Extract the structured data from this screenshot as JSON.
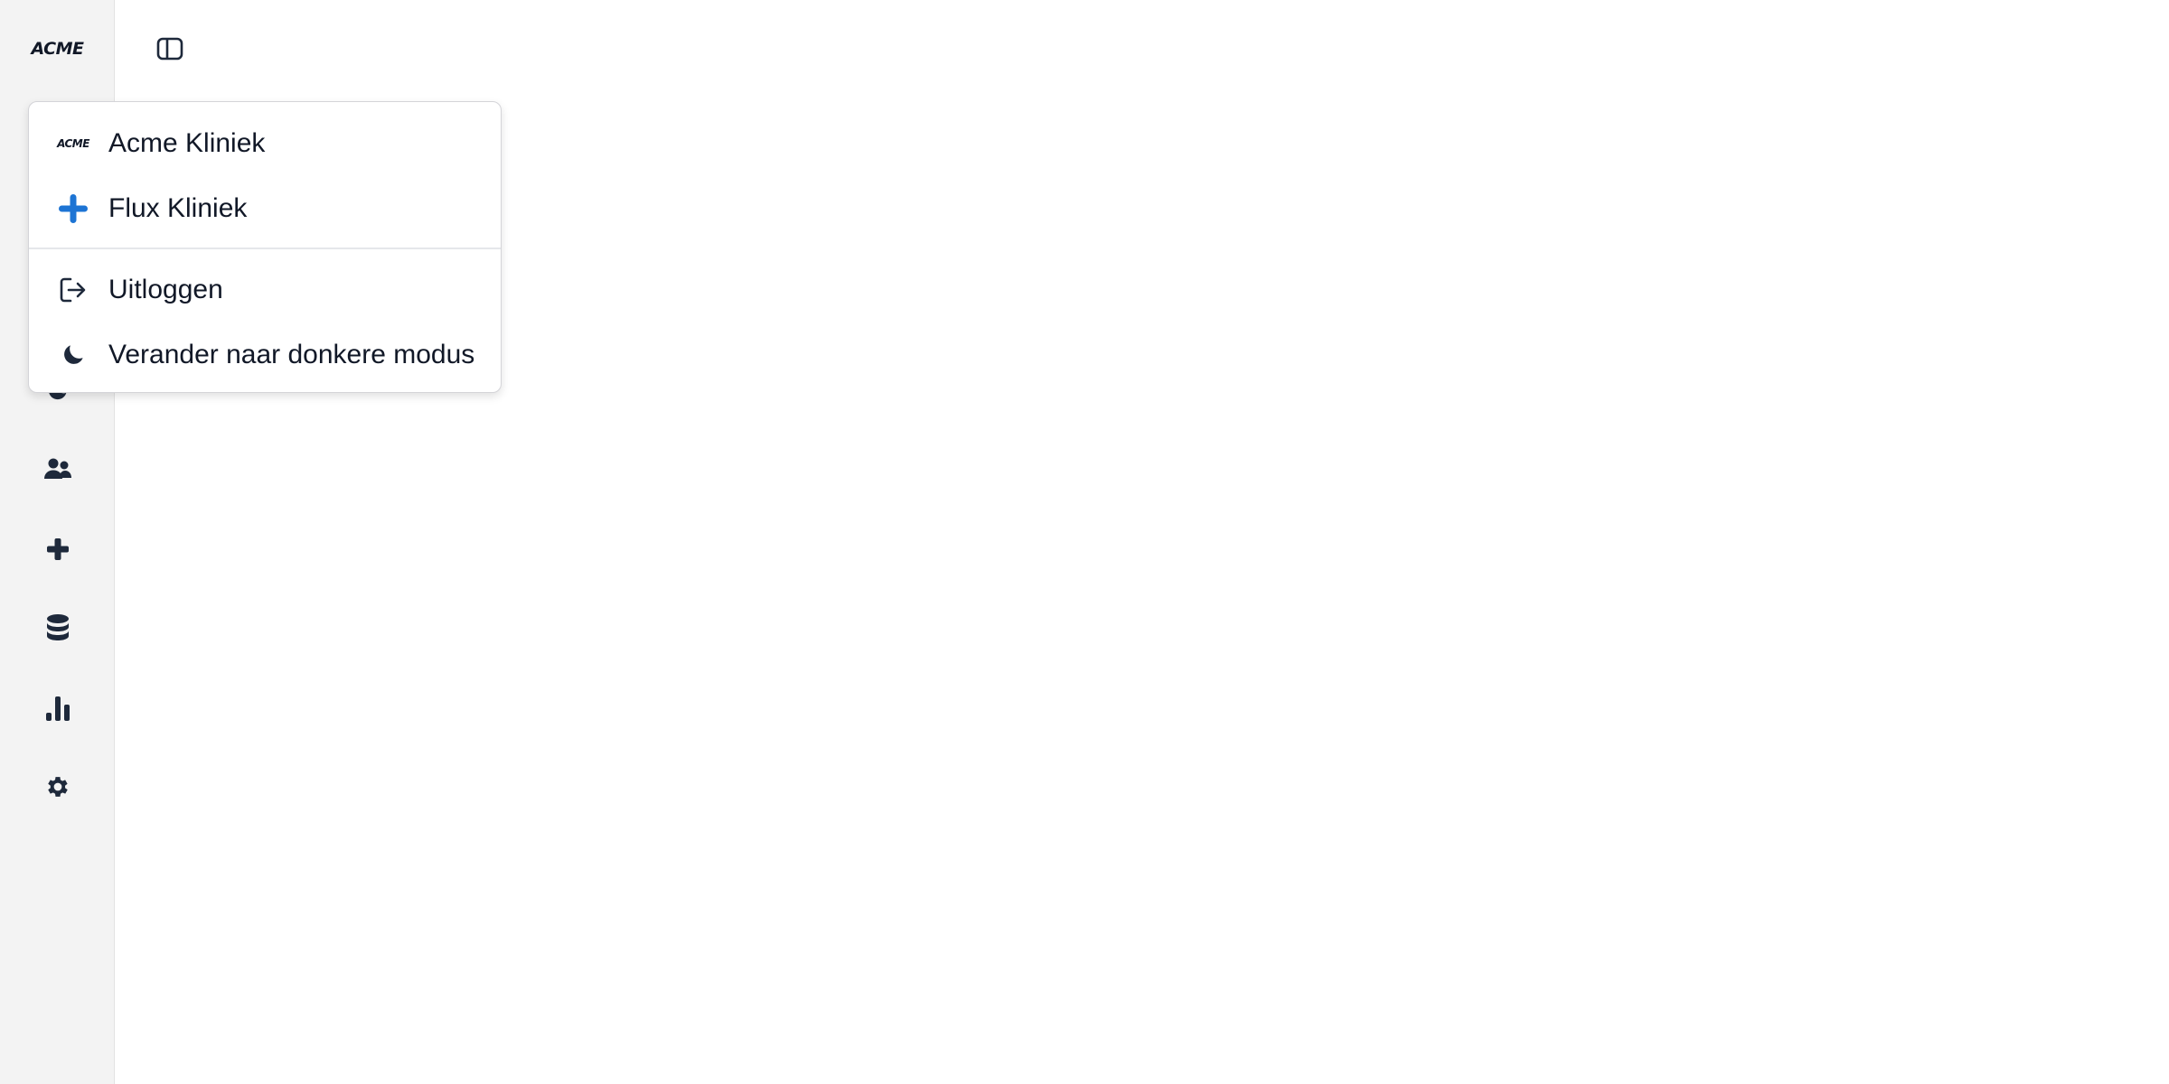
{
  "sidebar": {
    "logo_text": "ACME",
    "nav_icons": [
      {
        "name": "moon-icon"
      },
      {
        "name": "users-icon"
      },
      {
        "name": "plus-icon"
      },
      {
        "name": "database-icon"
      },
      {
        "name": "bar-chart-icon"
      },
      {
        "name": "gear-icon"
      }
    ]
  },
  "header": {
    "toggle_icon": "sidebar-toggle-icon"
  },
  "menu": {
    "organizations": [
      {
        "label": "Acme Kliniek",
        "icon": "acme-logo-icon"
      },
      {
        "label": "Flux Kliniek",
        "icon": "blue-plus-icon",
        "icon_color": "#1d74d4"
      }
    ],
    "actions": [
      {
        "label": "Uitloggen",
        "icon": "logout-icon"
      },
      {
        "label": "Verander naar donkere modus",
        "icon": "moon-icon"
      }
    ]
  },
  "colors": {
    "sidebar_bg": "#f3f3f3",
    "icon_dark": "#1e293b",
    "accent_blue": "#1d74d4"
  }
}
